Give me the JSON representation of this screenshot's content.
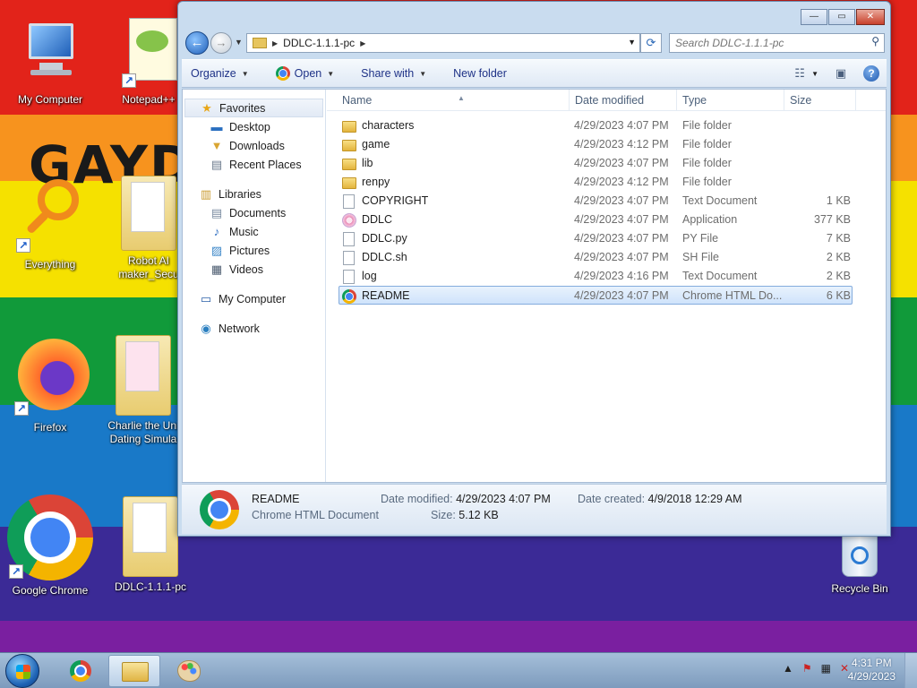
{
  "desktop": {
    "background_text": "GAYD",
    "icons": [
      {
        "id": "my-computer",
        "label": "My Computer"
      },
      {
        "id": "notepad",
        "label": "Notepad++"
      },
      {
        "id": "everything",
        "label": "Everything"
      },
      {
        "id": "robot-ai",
        "label": "Robot AI maker_Secu"
      },
      {
        "id": "firefox",
        "label": "Firefox"
      },
      {
        "id": "charlie",
        "label": "Charlie the Uni Dating Simula"
      },
      {
        "id": "google-chrome",
        "label": "Google Chrome"
      },
      {
        "id": "ddlc-folder",
        "label": "DDLC-1.1.1-pc"
      },
      {
        "id": "recycle-bin",
        "label": "Recycle Bin"
      }
    ]
  },
  "window": {
    "buttons": {
      "minimize": "—",
      "maximize": "▭",
      "close": "✕"
    },
    "address": {
      "path": "DDLC-1.1.1-pc"
    },
    "search": {
      "placeholder": "Search DDLC-1.1.1-pc"
    },
    "toolbar": {
      "organize": "Organize",
      "open": "Open",
      "share_with": "Share with",
      "new_folder": "New folder"
    },
    "nav": {
      "favorites": "Favorites",
      "desktop": "Desktop",
      "downloads": "Downloads",
      "recent_places": "Recent Places",
      "libraries": "Libraries",
      "documents": "Documents",
      "music": "Music",
      "pictures": "Pictures",
      "videos": "Videos",
      "my_computer": "My Computer",
      "network": "Network"
    },
    "columns": {
      "name": "Name",
      "date_modified": "Date modified",
      "type": "Type",
      "size": "Size"
    },
    "files": [
      {
        "name": "characters",
        "date": "4/29/2023 4:07 PM",
        "type": "File folder",
        "size": "",
        "icon": "folder"
      },
      {
        "name": "game",
        "date": "4/29/2023 4:12 PM",
        "type": "File folder",
        "size": "",
        "icon": "folder"
      },
      {
        "name": "lib",
        "date": "4/29/2023 4:07 PM",
        "type": "File folder",
        "size": "",
        "icon": "folder"
      },
      {
        "name": "renpy",
        "date": "4/29/2023 4:12 PM",
        "type": "File folder",
        "size": "",
        "icon": "folder"
      },
      {
        "name": "COPYRIGHT",
        "date": "4/29/2023 4:07 PM",
        "type": "Text Document",
        "size": "1 KB",
        "icon": "doc"
      },
      {
        "name": "DDLC",
        "date": "4/29/2023 4:07 PM",
        "type": "Application",
        "size": "377 KB",
        "icon": "app"
      },
      {
        "name": "DDLC.py",
        "date": "4/29/2023 4:07 PM",
        "type": "PY File",
        "size": "7 KB",
        "icon": "doc"
      },
      {
        "name": "DDLC.sh",
        "date": "4/29/2023 4:07 PM",
        "type": "SH File",
        "size": "2 KB",
        "icon": "doc"
      },
      {
        "name": "log",
        "date": "4/29/2023 4:16 PM",
        "type": "Text Document",
        "size": "2 KB",
        "icon": "doc"
      },
      {
        "name": "README",
        "date": "4/29/2023 4:07 PM",
        "type": "Chrome HTML Do...",
        "size": "6 KB",
        "icon": "chrome",
        "selected": true
      }
    ],
    "details": {
      "name": "README",
      "type": "Chrome HTML Document",
      "date_modified_label": "Date modified:",
      "date_modified": "4/29/2023 4:07 PM",
      "size_label": "Size:",
      "size": "5.12 KB",
      "date_created_label": "Date created:",
      "date_created": "4/9/2018 12:29 AM"
    }
  },
  "taskbar": {
    "clock_time": "4:31 PM",
    "clock_date": "4/29/2023"
  }
}
